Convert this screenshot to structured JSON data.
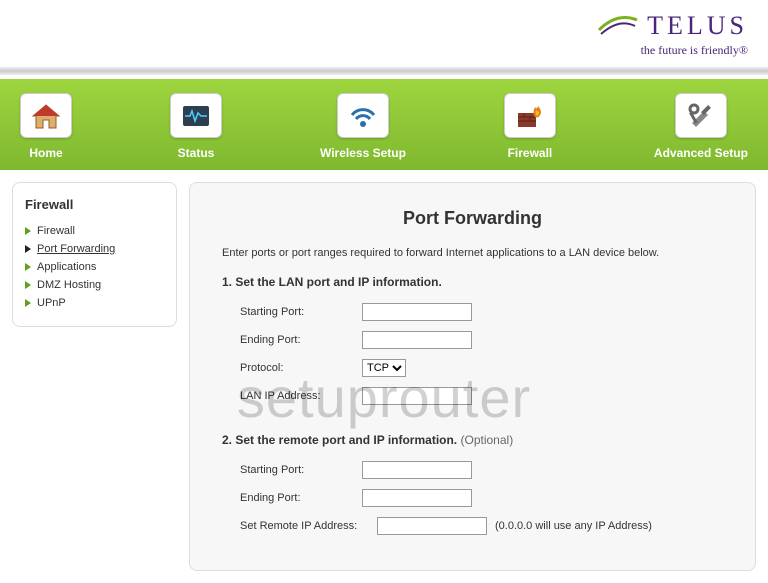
{
  "brand": {
    "name": "TELUS",
    "tagline": "the future is friendly®"
  },
  "nav": [
    {
      "label": "Home"
    },
    {
      "label": "Status"
    },
    {
      "label": "Wireless Setup"
    },
    {
      "label": "Firewall"
    },
    {
      "label": "Advanced Setup"
    }
  ],
  "sidebar": {
    "title": "Firewall",
    "items": [
      {
        "label": "Firewall"
      },
      {
        "label": "Port Forwarding"
      },
      {
        "label": "Applications"
      },
      {
        "label": "DMZ Hosting"
      },
      {
        "label": "UPnP"
      }
    ]
  },
  "main": {
    "title": "Port Forwarding",
    "intro": "Enter ports or port ranges required to forward Internet applications to a LAN device below.",
    "section1": {
      "heading": "1. Set the LAN port and IP information.",
      "starting_port_label": "Starting Port:",
      "starting_port_value": "",
      "ending_port_label": "Ending Port:",
      "ending_port_value": "",
      "protocol_label": "Protocol:",
      "protocol_value": "TCP",
      "lan_ip_label": "LAN IP Address:",
      "lan_ip_value": ""
    },
    "section2": {
      "heading": "2. Set the remote port and IP information.",
      "optional": "(Optional)",
      "starting_port_label": "Starting Port:",
      "starting_port_value": "",
      "ending_port_label": "Ending Port:",
      "ending_port_value": "",
      "remote_ip_label": "Set Remote IP Address:",
      "remote_ip_value": "",
      "remote_ip_note": "(0.0.0.0 will use any IP Address)"
    }
  },
  "watermark": "setuprouter"
}
